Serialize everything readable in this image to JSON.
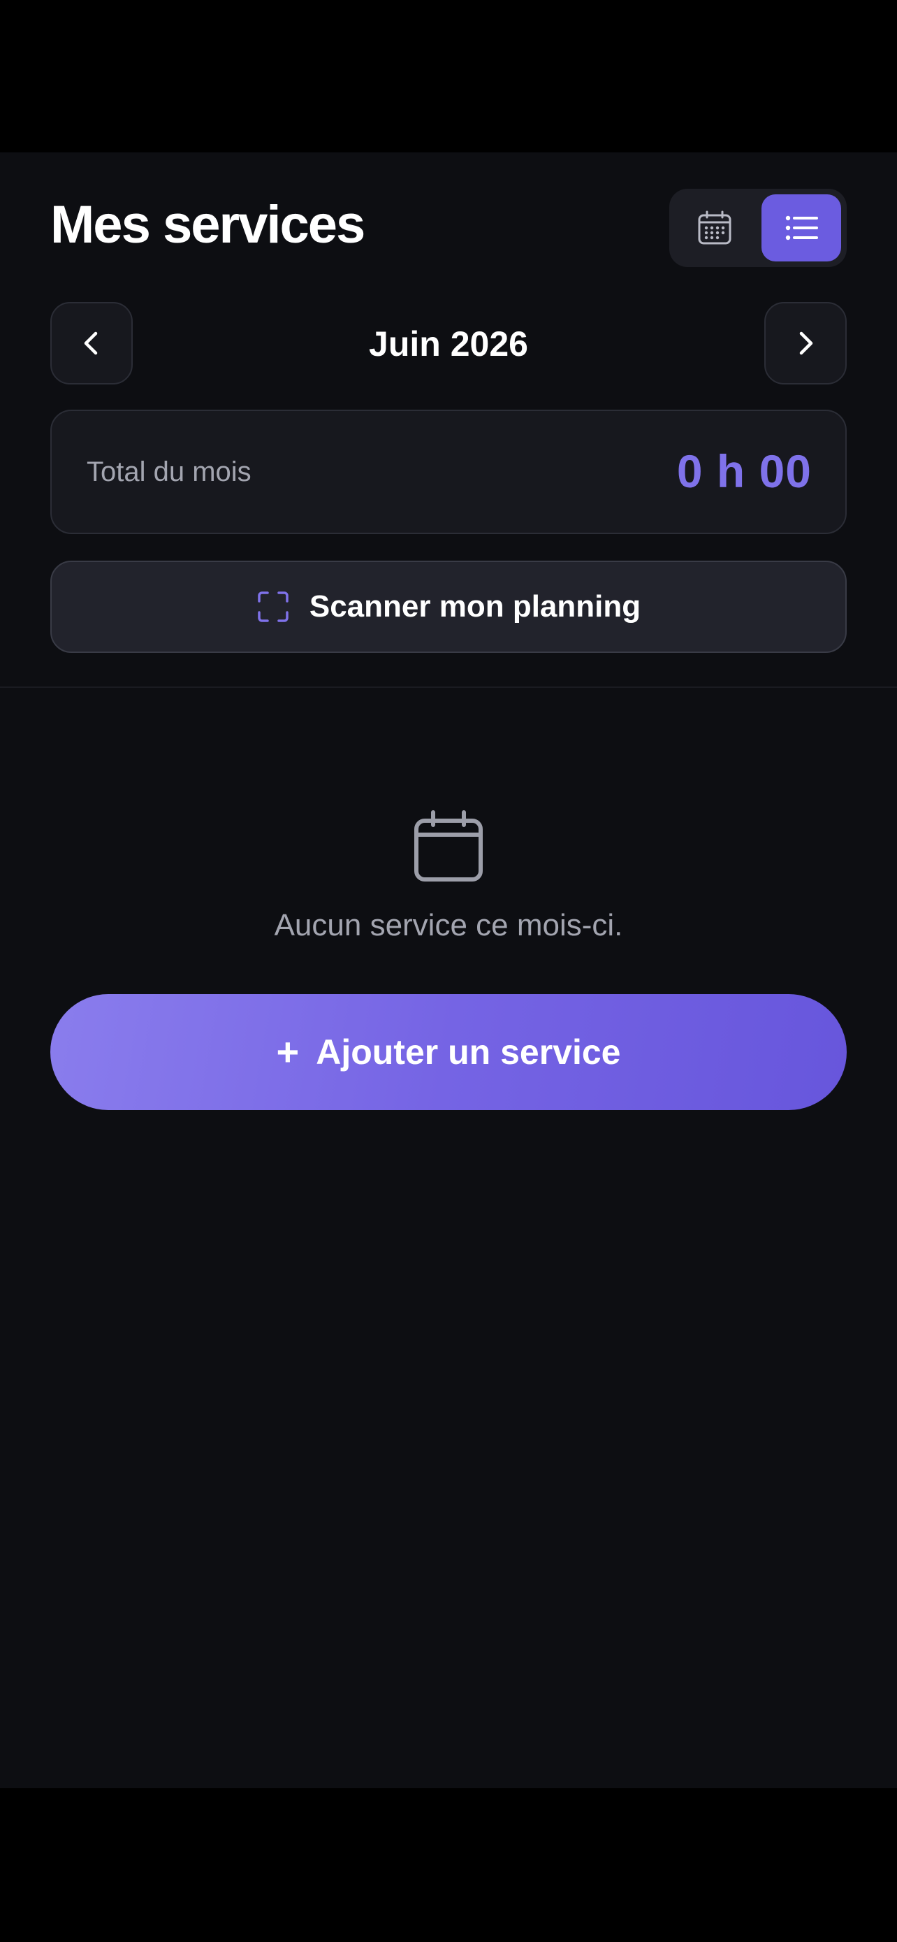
{
  "header": {
    "title": "Mes services",
    "view_toggle": {
      "options": [
        {
          "name": "calendar",
          "icon": "calendar-icon",
          "active": false
        },
        {
          "name": "list",
          "icon": "list-icon",
          "active": true
        }
      ]
    }
  },
  "month_nav": {
    "label": "Juin 2026",
    "prev_icon": "chevron-left-icon",
    "next_icon": "chevron-right-icon"
  },
  "summary": {
    "label": "Total du mois",
    "value": "0 h 00"
  },
  "scan_button": {
    "label": "Scanner mon planning",
    "icon": "scan-icon"
  },
  "empty_state": {
    "icon": "calendar-icon",
    "message": "Aucun service ce mois-ci."
  },
  "add_button": {
    "plus": "+",
    "label": "Ajouter un service"
  },
  "colors": {
    "background": "#0d0e12",
    "card": "#17181e",
    "accent": "#6b5ce0",
    "accent_text": "#7f72ea",
    "muted_text": "#a3a5b0"
  }
}
